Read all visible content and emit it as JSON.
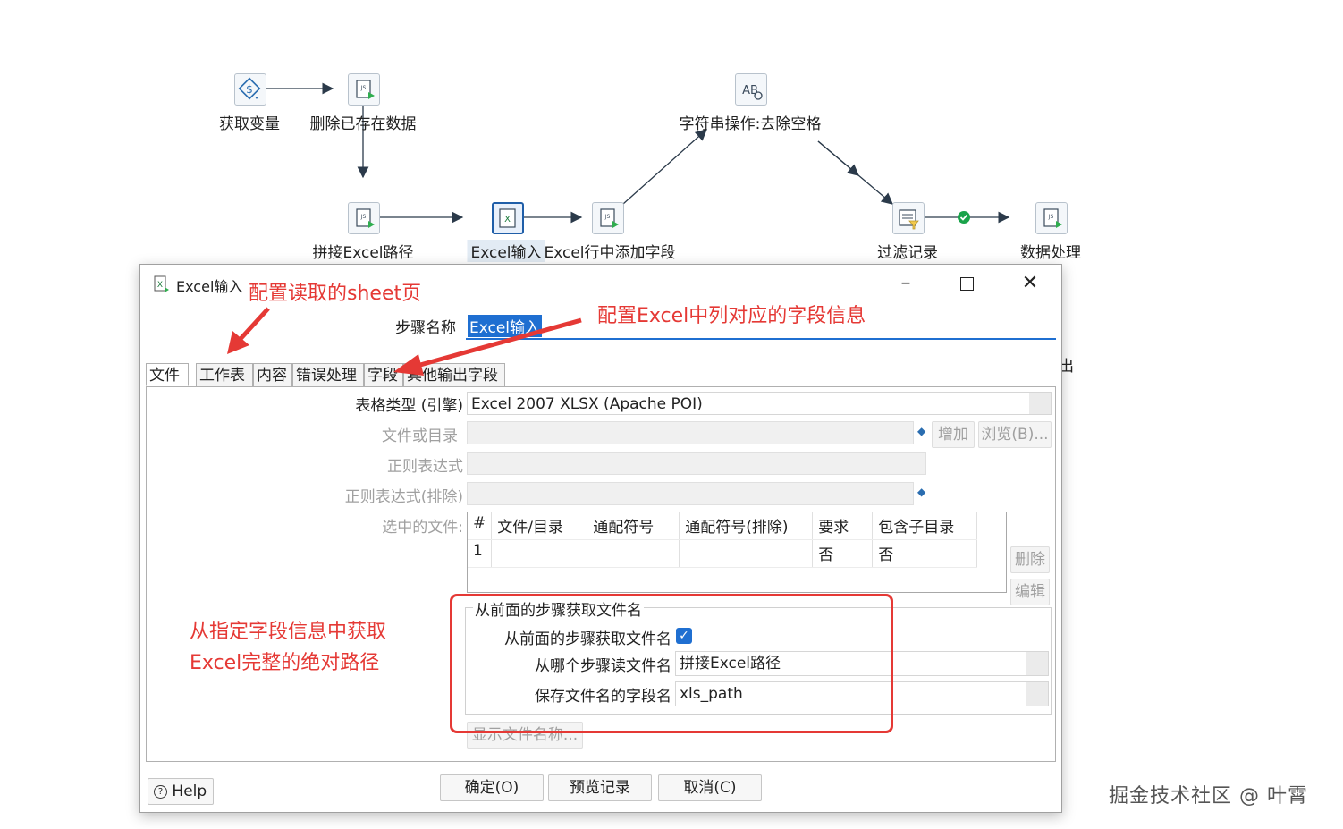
{
  "canvas": {
    "nodes": [
      {
        "label": "获取变量",
        "icon": "get-variables-icon"
      },
      {
        "label": "删除已存在数据",
        "icon": "script-icon"
      },
      {
        "label": "拼接Excel路径",
        "icon": "script-icon"
      },
      {
        "label": "Excel输入",
        "icon": "excel-input-icon"
      },
      {
        "label": "Excel行中添加字段",
        "icon": "script-icon"
      },
      {
        "label": "字符串操作:去除空格",
        "icon": "string-operations-icon"
      },
      {
        "label": "过滤记录",
        "icon": "filter-rows-icon"
      },
      {
        "label": "数据处理",
        "icon": "script-icon"
      }
    ]
  },
  "dialog": {
    "title": "Excel输入",
    "step_name_label": "步骤名称",
    "step_name_value": "Excel输入",
    "tabs": [
      "文件",
      "工作表",
      "内容",
      "错误处理",
      "字段",
      "其他输出字段"
    ],
    "active_tab": "文件",
    "file_tab": {
      "engine_label": "表格类型 (引擎)",
      "engine_value": "Excel 2007 XLSX (Apache POI)",
      "file_or_dir_label": "文件或目录",
      "add_button": "增加",
      "browse_button": "浏览(B)...",
      "regex_label": "正则表达式",
      "regex_exclude_label": "正则表达式(排除)",
      "selected_files_label": "选中的文件:",
      "grid_columns": [
        "#",
        "文件/目录",
        "通配符号",
        "通配符号(排除)",
        "要求",
        "包含子目录"
      ],
      "grid_rows": [
        [
          "1",
          "",
          "",
          "",
          "否",
          "否"
        ]
      ],
      "delete_button": "删除",
      "edit_button": "编辑",
      "from_prev_group_title": "从前面的步骤获取文件名",
      "from_prev_checkbox_label": "从前面的步骤获取文件名",
      "from_prev_checked": true,
      "read_step_label": "从哪个步骤读文件名",
      "read_step_value": "拼接Excel路径",
      "field_name_label": "保存文件名的字段名",
      "field_name_value": "xls_path",
      "show_filenames_button": "显示文件名称..."
    },
    "buttons": {
      "help": "Help",
      "ok": "确定(O)",
      "preview": "预览记录",
      "cancel": "取消(C)"
    },
    "partial_right_glyph": "出"
  },
  "annotations": {
    "sheet_tab": "配置读取的sheet页",
    "field_tab": "配置Excel中列对应的字段信息",
    "path_line1": "从指定字段信息中获取",
    "path_line2": "Excel完整的绝对路径"
  },
  "watermark": "掘金技术社区 @ 叶霄",
  "colors": {
    "accent": "#1f6fd1",
    "annotation_red": "#e53935",
    "ok_green": "#1aa34a"
  }
}
